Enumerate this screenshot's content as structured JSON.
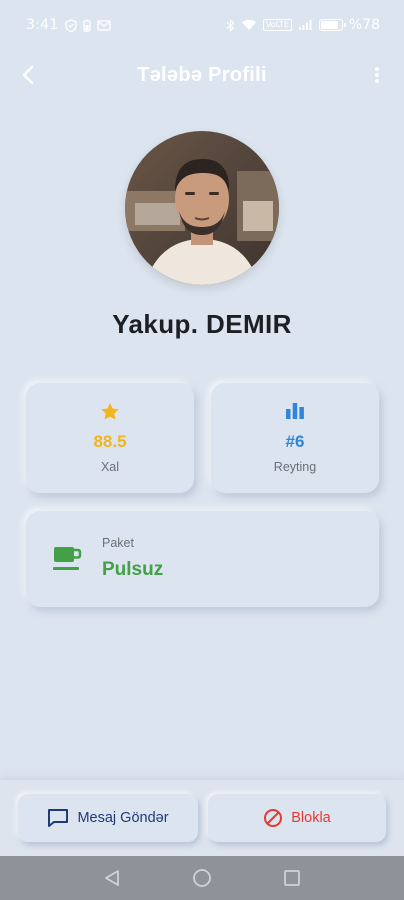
{
  "status_bar": {
    "time": "3:41",
    "battery_text": "%78",
    "battery_level": 0.78,
    "sim_badge": "VoLTE"
  },
  "app_bar": {
    "title": "Tələbə Profili",
    "back_icon": "arrow-back-icon",
    "more_icon": "more-vert-icon"
  },
  "profile": {
    "name": "Yakup. DEMIR",
    "avatar_icon": "profile-photo"
  },
  "stats": {
    "score": {
      "value": "88.5",
      "label": "Xal",
      "icon": "star-icon",
      "color": "#f2b51a"
    },
    "rank": {
      "value": "#6",
      "label": "Reyting",
      "icon": "bar-chart-icon",
      "color": "#2f86d8"
    }
  },
  "package": {
    "label": "Paket",
    "value": "Pulsuz",
    "icon": "cup-icon",
    "color": "#43a047"
  },
  "actions": {
    "message_label": "Mesaj Göndər",
    "block_label": "Blokla",
    "block_color": "#e53935"
  },
  "colors": {
    "background": "#dce4ef",
    "title": "#ffffff"
  }
}
